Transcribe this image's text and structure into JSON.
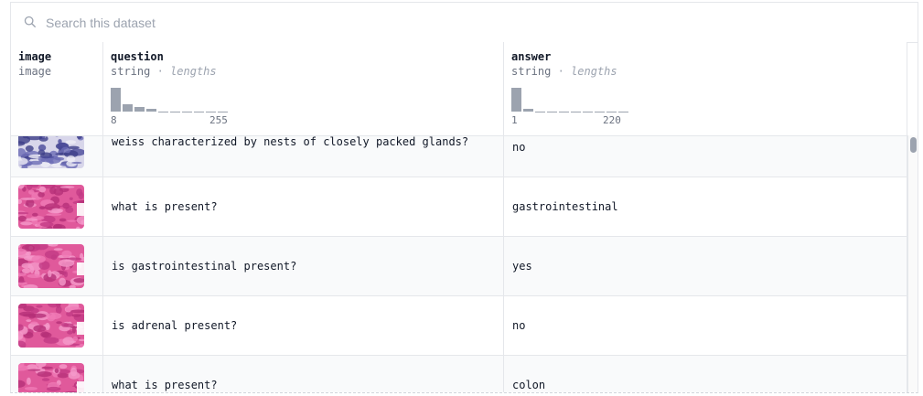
{
  "search": {
    "placeholder": "Search this dataset",
    "value": ""
  },
  "columns": [
    {
      "name": "image",
      "type": "image",
      "has_hist": false
    },
    {
      "name": "question",
      "type": "string",
      "hist_label": "lengths",
      "min": "8",
      "max": "255",
      "hist_levels": [
        1.0,
        0.3,
        0.18,
        0.1,
        0.04,
        0.04,
        0.04,
        0.04,
        0.04,
        0.04
      ]
    },
    {
      "name": "answer",
      "type": "string",
      "hist_label": "lengths",
      "min": "1",
      "max": "220",
      "hist_levels": [
        1.0,
        0.12,
        0.04,
        0.04,
        0.04,
        0.04,
        0.04,
        0.04,
        0.04,
        0.04
      ]
    }
  ],
  "separator": "·",
  "rows": [
    {
      "image": "histology-thumbnail-blue",
      "question": "is endoscopic view of a longitudinally-oriented mallory-\nweiss characterized by nests of closely packed glands?",
      "answer": "no"
    },
    {
      "image": "histology-thumbnail-pink",
      "question": "what is present?",
      "answer": "gastrointestinal"
    },
    {
      "image": "histology-thumbnail-pink",
      "question": "is gastrointestinal present?",
      "answer": "yes"
    },
    {
      "image": "histology-thumbnail-pink",
      "question": "is adrenal present?",
      "answer": "no"
    },
    {
      "image": "histology-thumbnail-pink",
      "question": "what is present?",
      "answer": "colon"
    }
  ],
  "colors": {
    "hist_bar": "#9ca3af",
    "border": "#e5e7eb",
    "row_alt": "#f9fafb"
  }
}
